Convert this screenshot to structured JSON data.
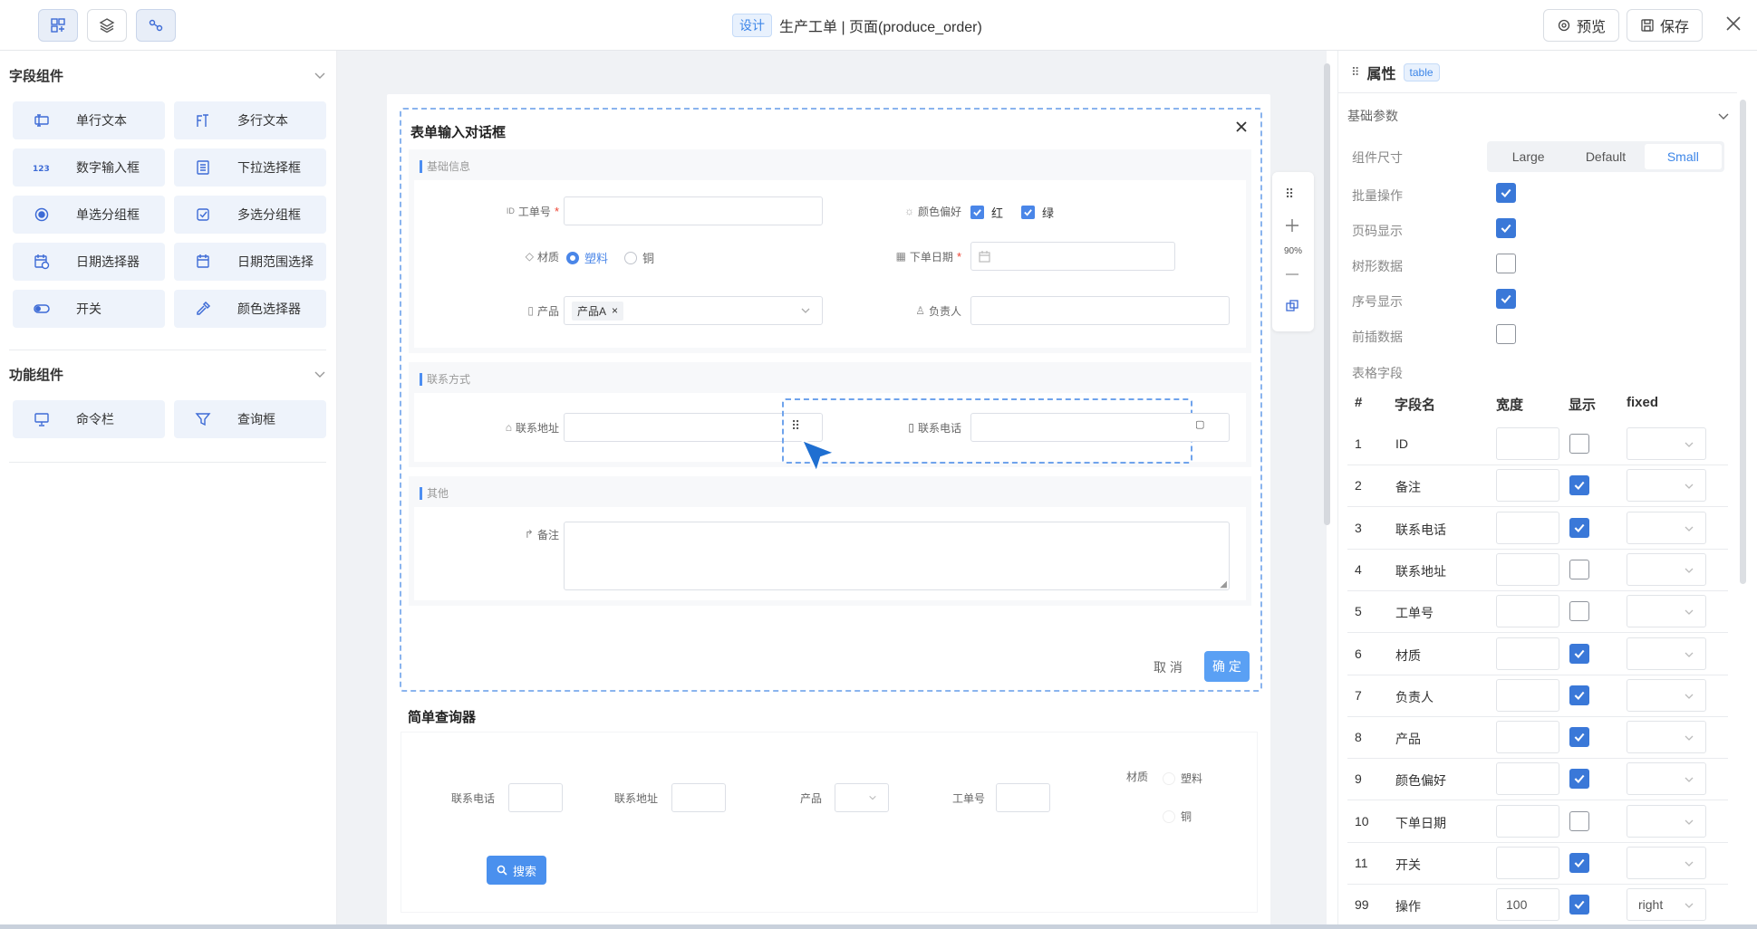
{
  "topbar": {
    "design_tag": "设计",
    "title": "生产工单 | 页面(produce_order)",
    "preview": "预览",
    "save": "保存"
  },
  "left_panel": {
    "field_group": "字段组件",
    "field_items": [
      "单行文本",
      "多行文本",
      "数字输入框",
      "下拉选择框",
      "单选分组框",
      "多选分组框",
      "日期选择器",
      "日期范围选择",
      "开关",
      "颜色选择器"
    ],
    "func_group": "功能组件",
    "func_items": [
      "命令栏",
      "查询框"
    ]
  },
  "dialog": {
    "title": "表单输入对话框",
    "sections": {
      "basic": "基础信息",
      "contact": "联系方式",
      "other": "其他"
    },
    "fields": {
      "order_no": "工单号",
      "color_pref": "颜色偏好",
      "color_red": "红",
      "color_green": "绿",
      "material": "材质",
      "mat_plastic": "塑料",
      "mat_copper": "铜",
      "order_date": "下单日期",
      "product": "产品",
      "product_tag": "产品A",
      "owner": "负责人",
      "address": "联系地址",
      "phone": "联系电话",
      "remark": "备注"
    },
    "cancel": "取 消",
    "confirm": "确 定"
  },
  "float_tools": {
    "zoom": "90%"
  },
  "query": {
    "title": "简单查询器",
    "phone": "联系电话",
    "address": "联系地址",
    "product": "产品",
    "order_no": "工单号",
    "material": "材质",
    "mat_plastic": "塑料",
    "mat_copper": "铜",
    "search": "搜索"
  },
  "right_panel": {
    "props_label": "属性",
    "props_tag": "table",
    "basic_params": "基础参数",
    "size_label": "组件尺寸",
    "sizes": [
      "Large",
      "Default",
      "Small"
    ],
    "selected_size": "Small",
    "options": [
      {
        "label": "批量操作",
        "checked": true
      },
      {
        "label": "页码显示",
        "checked": true
      },
      {
        "label": "树形数据",
        "checked": false
      },
      {
        "label": "序号显示",
        "checked": true
      },
      {
        "label": "前插数据",
        "checked": false
      }
    ],
    "table_fields_label": "表格字段",
    "headers": [
      "#",
      "字段名",
      "宽度",
      "显示",
      "fixed"
    ],
    "rows": [
      {
        "no": "1",
        "name": "ID",
        "width": "",
        "show": false,
        "fixed": ""
      },
      {
        "no": "2",
        "name": "备注",
        "width": "",
        "show": true,
        "fixed": ""
      },
      {
        "no": "3",
        "name": "联系电话",
        "width": "",
        "show": true,
        "fixed": ""
      },
      {
        "no": "4",
        "name": "联系地址",
        "width": "",
        "show": false,
        "fixed": ""
      },
      {
        "no": "5",
        "name": "工单号",
        "width": "",
        "show": false,
        "fixed": ""
      },
      {
        "no": "6",
        "name": "材质",
        "width": "",
        "show": true,
        "fixed": ""
      },
      {
        "no": "7",
        "name": "负责人",
        "width": "",
        "show": true,
        "fixed": ""
      },
      {
        "no": "8",
        "name": "产品",
        "width": "",
        "show": true,
        "fixed": ""
      },
      {
        "no": "9",
        "name": "颜色偏好",
        "width": "",
        "show": true,
        "fixed": ""
      },
      {
        "no": "10",
        "name": "下单日期",
        "width": "",
        "show": false,
        "fixed": ""
      },
      {
        "no": "11",
        "name": "开关",
        "width": "",
        "show": true,
        "fixed": ""
      },
      {
        "no": "99",
        "name": "操作",
        "width": "100",
        "show": true,
        "fixed": "right"
      }
    ]
  },
  "colors": {
    "accent": "#4a86e8",
    "component_bg": "#eef3fb",
    "canvas_bg": "#f0f2f5"
  }
}
